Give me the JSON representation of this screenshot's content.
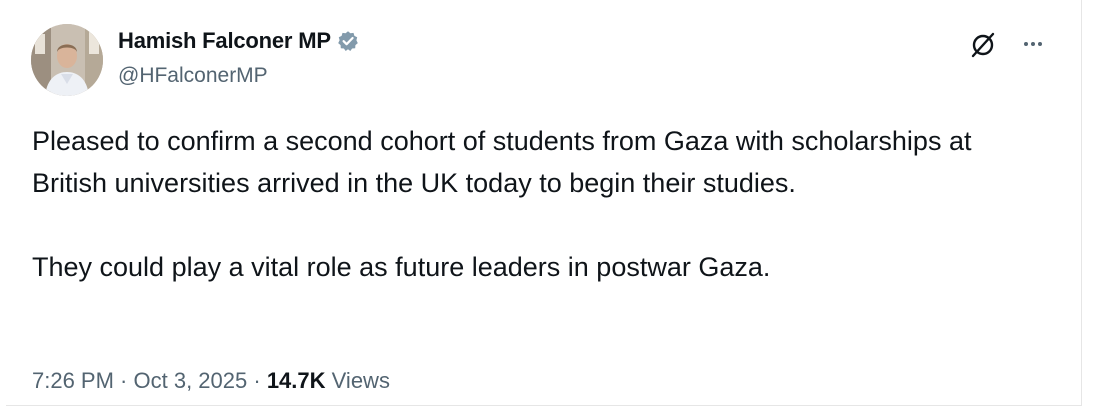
{
  "author": {
    "name": "Hamish Falconer MP",
    "handle": "@HFalconerMP",
    "verified_badge_color": "#829aab"
  },
  "tweet": {
    "paragraphs": [
      "Pleased to confirm a second cohort of students from Gaza with scholarships at British universities arrived in the UK today to begin their studies.",
      "They could play a vital role as future leaders in postwar Gaza."
    ]
  },
  "meta": {
    "time": "7:26 PM",
    "separator1": " · ",
    "date": "Oct 3, 2025",
    "separator2": " · ",
    "views_count": "14.7K",
    "views_label": "Views"
  },
  "icons": {
    "grok": "grok-icon",
    "more": "more-options-icon",
    "verified": "verified-badge-icon"
  },
  "colors": {
    "text_primary": "#0f1419",
    "text_secondary": "#536471"
  }
}
